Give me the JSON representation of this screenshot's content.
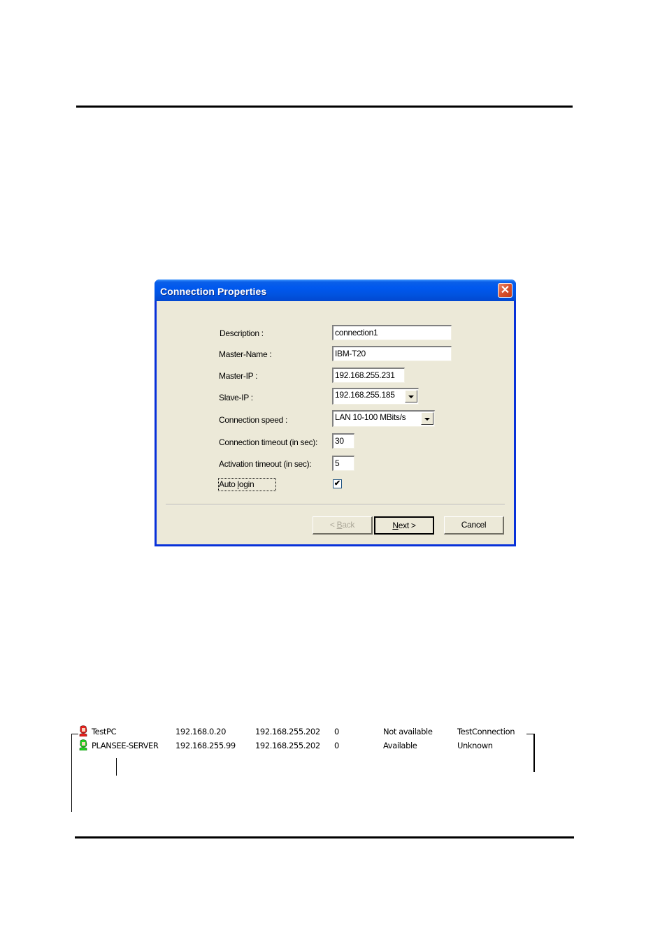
{
  "dialog": {
    "title": "Connection Properties",
    "close_icon": "close-icon",
    "fields": {
      "description": {
        "label": "Description :",
        "value": "connection1"
      },
      "master_name": {
        "label": "Master-Name :",
        "value": "IBM-T20"
      },
      "master_ip": {
        "label": "Master-IP :",
        "value": "192.168.255.231"
      },
      "slave_ip": {
        "label": "Slave-IP :",
        "value": "192.168.255.185"
      },
      "connection_speed": {
        "label": "Connection speed :",
        "value": "LAN 10-100 MBits/s"
      },
      "connection_timeout": {
        "label": "Connection timeout (in sec):",
        "value": "30"
      },
      "activation_timeout": {
        "label": "Activation timeout (in sec):",
        "value": "5"
      },
      "auto_login": {
        "label_pre": "Auto ",
        "label_accel": "l",
        "label_post": "ogin",
        "checked": true,
        "check_glyph": "✔"
      }
    },
    "buttons": {
      "back": {
        "pre": "< ",
        "accel": "B",
        "post": "ack",
        "enabled": false
      },
      "next": {
        "accel": "N",
        "post": "ext >",
        "default": true
      },
      "cancel": {
        "label": "Cancel"
      }
    }
  },
  "connection_list": {
    "rows": [
      {
        "name": "TestPC",
        "ip": "192.168.0.20",
        "remote_ip": "192.168.255.202",
        "count": "0",
        "status": "Not available",
        "connection": "TestConnection",
        "icon_color": "#e8201c"
      },
      {
        "name": "PLANSEE-SERVER",
        "ip": "192.168.255.99",
        "remote_ip": "192.168.255.202",
        "count": "0",
        "status": "Available",
        "connection": "Unknown",
        "icon_color": "#22d020"
      }
    ]
  }
}
